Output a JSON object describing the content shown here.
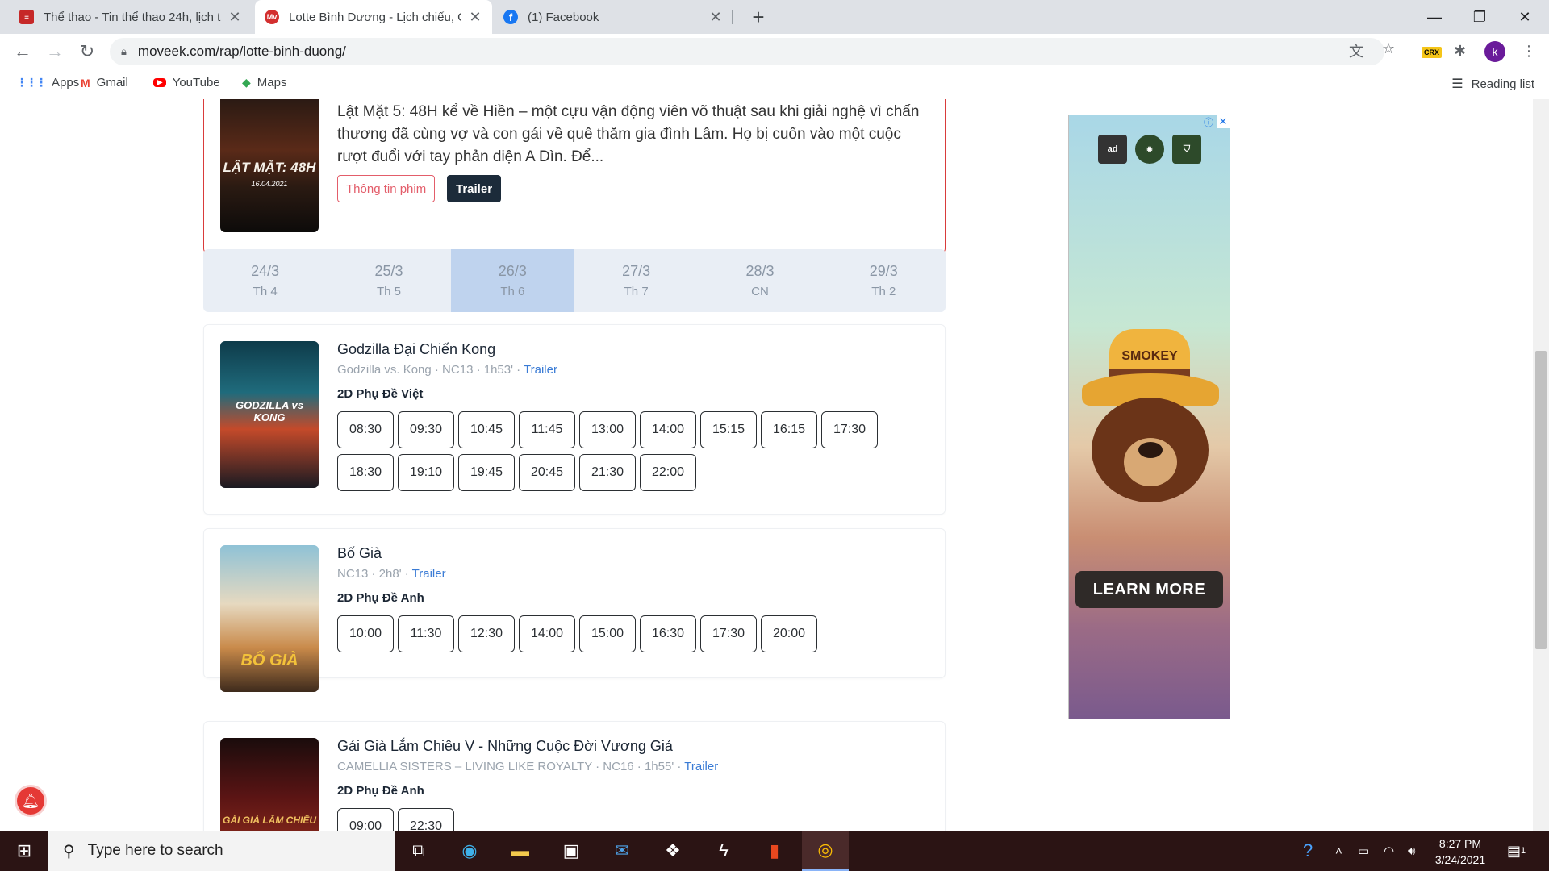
{
  "browser": {
    "tabs": [
      {
        "title": "Thể thao - Tin thể thao 24h, lịch t",
        "favicon_color": "#c62828",
        "favicon_glyph": "≡"
      },
      {
        "title": "Lotte Bình Dương - Lịch chiếu, Gi",
        "favicon_color": "#d32f2f",
        "favicon_glyph": "Mv"
      },
      {
        "title": "(1) Facebook",
        "favicon_color": "#1877f2",
        "favicon_glyph": "f"
      }
    ],
    "url": "moveek.com/rap/lotte-binh-duong/",
    "profile_initial": "k",
    "crx_label": "CRX",
    "bookmarks": {
      "apps": "Apps",
      "gmail": "Gmail",
      "youtube": "YouTube",
      "maps": "Maps",
      "reading_list": "Reading list"
    }
  },
  "featured": {
    "description": "Lật Mặt 5: 48H kể về Hiền – một cựu vận động viên võ thuật sau khi giải nghệ vì chấn thương đã cùng vợ và con gái về quê thăm gia đình Lâm. Họ bị cuốn vào một cuộc rượt đuổi với tay phản diện A Dìn. Để...",
    "poster_title": "LẬT MẶT: 48H",
    "poster_date": "16.04.2021",
    "info_button": "Thông tin phim",
    "trailer_button": "Trailer"
  },
  "dates": [
    {
      "day": "24/3",
      "weekday": "Th 4"
    },
    {
      "day": "25/3",
      "weekday": "Th 5"
    },
    {
      "day": "26/3",
      "weekday": "Th 6"
    },
    {
      "day": "27/3",
      "weekday": "Th 7"
    },
    {
      "day": "28/3",
      "weekday": "CN"
    },
    {
      "day": "29/3",
      "weekday": "Th 2"
    }
  ],
  "selected_date_index": 2,
  "movies": [
    {
      "title": "Godzilla Đại Chiến Kong",
      "meta": "Godzilla vs. Kong · NC13 · 1h53' · ",
      "trailer": "Trailer",
      "format": "2D Phụ Đề Việt",
      "poster_title": "GODZILLA vs KONG",
      "times": [
        "08:30",
        "09:30",
        "10:45",
        "11:45",
        "13:00",
        "14:00",
        "15:15",
        "16:15",
        "17:30",
        "18:30",
        "19:10",
        "19:45",
        "20:45",
        "21:30",
        "22:00"
      ]
    },
    {
      "title": "Bố Già",
      "meta": "NC13 · 2h8' · ",
      "trailer": "Trailer",
      "format": "2D Phụ Đề Anh",
      "poster_title": "BỐ GIÀ",
      "times": [
        "10:00",
        "11:30",
        "12:30",
        "14:00",
        "15:00",
        "16:30",
        "17:30",
        "20:00"
      ]
    },
    {
      "title": "Gái Già Lắm Chiêu V - Những Cuộc Đời Vương Giả",
      "meta": "CAMELLIA SISTERS – LIVING LIKE ROYALTY · NC16 · 1h55' · ",
      "trailer": "Trailer",
      "format": "2D Phụ Đề Anh",
      "poster_title": "GÁI GIÀ LẮM CHIÊU",
      "times": [
        "09:00",
        "22:30"
      ]
    }
  ],
  "ad": {
    "hat_label": "SMOKEY",
    "cta": "LEARN MORE",
    "logo_ad": "ad"
  },
  "taskbar": {
    "search_placeholder": "Type here to search",
    "time": "8:27 PM",
    "date": "3/24/2021",
    "notification_count": "1"
  }
}
